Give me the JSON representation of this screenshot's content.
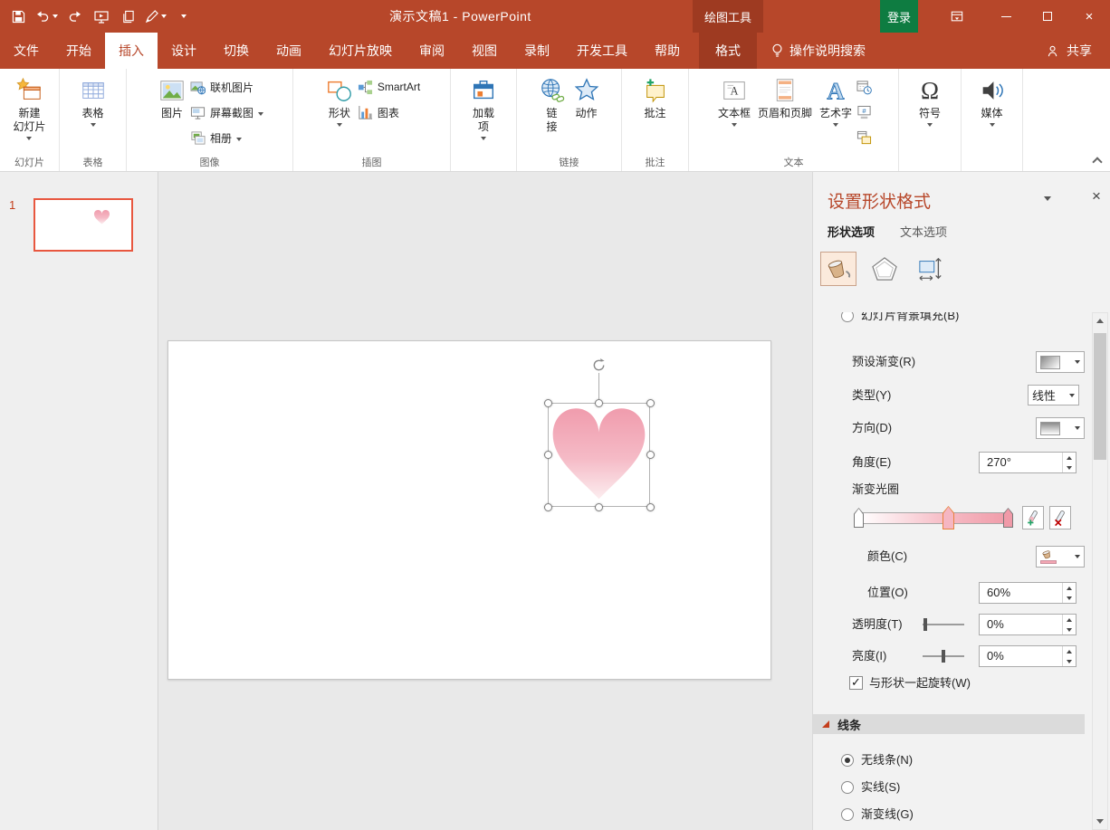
{
  "colors": {
    "accent": "#B7472A",
    "accent_dark": "#9E3A21",
    "signin_green": "#0E7C41",
    "selection_orange": "#E8573F",
    "heart_top": "#F09CAD",
    "heart_bottom": "#FCEDEF",
    "pane_title": "#B7472A",
    "gradient_stop_selected_outline": "#E8823C"
  },
  "icons": {
    "close": "×",
    "omega": "Ω",
    "hash": "#",
    "letter_a": "A"
  },
  "titlebar": {
    "title": "演示文稿1 - PowerPoint",
    "contextual_label": "绘图工具",
    "signin_label": "登录"
  },
  "tabs": {
    "file": "文件",
    "home": "开始",
    "insert": "插入",
    "design": "设计",
    "transitions": "切换",
    "animations": "动画",
    "slideshow": "幻灯片放映",
    "review": "审阅",
    "view": "视图",
    "record": "录制",
    "developer": "开发工具",
    "help": "帮助",
    "format": "格式",
    "tellme": "操作说明搜索",
    "share": "共享"
  },
  "ribbon": {
    "new_slide_lines": [
      "新建",
      "幻灯片"
    ],
    "table": "表格",
    "picture": "图片",
    "online_pictures": "联机图片",
    "screenshot": "屏幕截图",
    "photo_album": "相册",
    "shapes": "形状",
    "smartart": "SmartArt",
    "chart": "图表",
    "addins_lines": [
      "加载",
      "项"
    ],
    "link_lines": [
      "链",
      "接"
    ],
    "action": "动作",
    "comment": "批注",
    "textbox": "文本框",
    "header_footer": "页眉和页脚",
    "wordart": "艺术字",
    "symbol": "符号",
    "media": "媒体",
    "group_slides": "幻灯片",
    "group_tables": "表格",
    "group_images": "图像",
    "group_illustrations": "插图",
    "group_links": "链接",
    "group_comments": "批注",
    "group_text": "文本"
  },
  "slides_panel": {
    "slide_number": "1"
  },
  "format_pane": {
    "title": "设置形状格式",
    "tab_shape": "形状选项",
    "tab_text": "文本选项",
    "clipped_option": "幻灯片背景填充(B)",
    "preset_gradient_label": "预设渐变(R)",
    "type_label": "类型(Y)",
    "type_value": "线性",
    "direction_label": "方向(D)",
    "angle_label": "角度(E)",
    "angle_value": "270°",
    "gradient_stops_label": "渐变光圈",
    "gradient_stops": [
      {
        "position": "0%",
        "color": "#FFFFFF",
        "selected": false
      },
      {
        "position": "60%",
        "color": "#F5B6C2",
        "selected": true
      },
      {
        "position": "100%",
        "color": "#F09AA8",
        "selected": false
      }
    ],
    "color_label": "颜色(C)",
    "position_label": "位置(O)",
    "position_value": "60%",
    "transparency_label": "透明度(T)",
    "transparency_value": "0%",
    "brightness_label": "亮度(I)",
    "brightness_value": "0%",
    "rotate_with_shape_label": "与形状一起旋转(W)",
    "line_section_label": "线条",
    "no_line_label": "无线条(N)",
    "solid_line_label": "实线(S)",
    "gradient_line_label": "渐变线(G)"
  }
}
